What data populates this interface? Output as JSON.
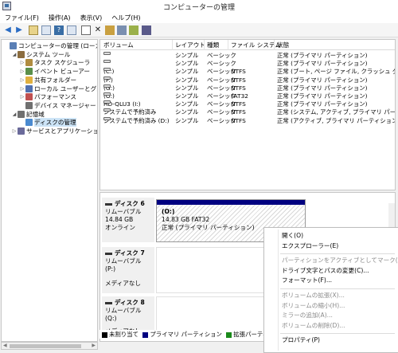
{
  "window": {
    "title": "コンピューターの管理"
  },
  "menu": [
    "ファイル(F)",
    "操作(A)",
    "表示(V)",
    "ヘルプ(H)"
  ],
  "tree": [
    {
      "label": "コンピューターの管理 (ローカル)",
      "indent": 0,
      "toggle": "",
      "icon": "computer-icon",
      "color": "#5a7fb5"
    },
    {
      "label": "システム ツール",
      "indent": 1,
      "toggle": "◢",
      "icon": "tools-icon",
      "color": "#8c6d3f"
    },
    {
      "label": "タスク スケジューラ",
      "indent": 2,
      "toggle": "▷",
      "icon": "clock-icon",
      "color": "#b08c40"
    },
    {
      "label": "イベント ビューアー",
      "indent": 2,
      "toggle": "▷",
      "icon": "event-icon",
      "color": "#5a8f4a"
    },
    {
      "label": "共有フォルダー",
      "indent": 2,
      "toggle": "▷",
      "icon": "folder-icon",
      "color": "#e0b040"
    },
    {
      "label": "ローカル ユーザーとグループ",
      "indent": 2,
      "toggle": "▷",
      "icon": "users-icon",
      "color": "#5070b0"
    },
    {
      "label": "パフォーマンス",
      "indent": 2,
      "toggle": "▷",
      "icon": "perf-icon",
      "color": "#c05050"
    },
    {
      "label": "デバイス マネージャー",
      "indent": 2,
      "toggle": "",
      "icon": "device-icon",
      "color": "#707070"
    },
    {
      "label": "記憶域",
      "indent": 1,
      "toggle": "◢",
      "icon": "storage-icon",
      "color": "#707070"
    },
    {
      "label": "ディスクの管理",
      "indent": 2,
      "toggle": "",
      "icon": "disk-icon",
      "color": "#4a8ad0",
      "selected": true
    },
    {
      "label": "サービスとアプリケーション",
      "indent": 1,
      "toggle": "▷",
      "icon": "services-icon",
      "color": "#6a6a9a"
    }
  ],
  "table": {
    "headers": [
      "ボリューム",
      "レイアウト",
      "種類",
      "ファイル システム",
      "状態"
    ],
    "rows": [
      [
        "",
        "シンプル",
        "ベーシック",
        "",
        "正常 (プライマリ パーティション)"
      ],
      [
        "",
        "シンプル",
        "ベーシック",
        "",
        "正常 (プライマリ パーティション)"
      ],
      [
        "(C:)",
        "シンプル",
        "ベーシック",
        "NTFS",
        "正常 (ブート, ページ ファイル, クラッシュ ダンプ, プ"
      ],
      [
        "(F:)",
        "シンプル",
        "ベーシック",
        "NTFS",
        "正常 (プライマリ パーティション)"
      ],
      [
        "(G:)",
        "シンプル",
        "ベーシック",
        "NTFS",
        "正常 (プライマリ パーティション)"
      ],
      [
        "(O:)",
        "シンプル",
        "ベーシック",
        "FAT32",
        "正常 (プライマリ パーティション)"
      ],
      [
        "HD-QLU3 (I:)",
        "シンプル",
        "ベーシック",
        "NTFS",
        "正常 (プライマリ パーティション)"
      ],
      [
        "システムで予約済み",
        "シンプル",
        "ベーシック",
        "NTFS",
        "正常 (システム, アクティブ, プライマリ パーティション)"
      ],
      [
        "システムで予約済み (D:)",
        "シンプル",
        "ベーシック",
        "NTFS",
        "正常 (アクティブ, プライマリ パーティション)"
      ]
    ]
  },
  "disks": [
    {
      "name": "ディスク 6",
      "type": "リムーバブル",
      "size": "14.84 GB",
      "status": "オンライン"
    },
    {
      "name": "ディスク 7",
      "type": "リムーバブル (P:)",
      "size": "",
      "status": "メディアなし"
    },
    {
      "name": "ディスク 8",
      "type": "リムーバブル (Q:)",
      "size": "",
      "status": "メディアなし"
    }
  ],
  "partition": {
    "label": "(O:)",
    "size": "14.83 GB FAT32",
    "status": "正常 (プライマリ パーティション)"
  },
  "legend": [
    {
      "label": "未割り当て",
      "color": "#000000"
    },
    {
      "label": "プライマリ パーティション",
      "color": "#000080"
    },
    {
      "label": "拡張パーティション",
      "color": "#1a8a1a"
    }
  ],
  "context_menu": [
    {
      "label": "開く(O)",
      "enabled": true
    },
    {
      "label": "エクスプローラー(E)",
      "enabled": true
    },
    {
      "sep": true
    },
    {
      "label": "パーティションをアクティブとしてマーク(M)",
      "enabled": false
    },
    {
      "label": "ドライブ文字とパスの変更(C)...",
      "enabled": true
    },
    {
      "label": "フォーマット(F)...",
      "enabled": true
    },
    {
      "sep": true
    },
    {
      "label": "ボリュームの拡張(X)...",
      "enabled": false
    },
    {
      "label": "ボリュームの縮小(H)...",
      "enabled": false
    },
    {
      "label": "ミラーの追加(A)...",
      "enabled": false
    },
    {
      "label": "ボリュームの削除(D)...",
      "enabled": false
    },
    {
      "sep": true
    },
    {
      "label": "プロパティ(P)",
      "enabled": true
    }
  ]
}
